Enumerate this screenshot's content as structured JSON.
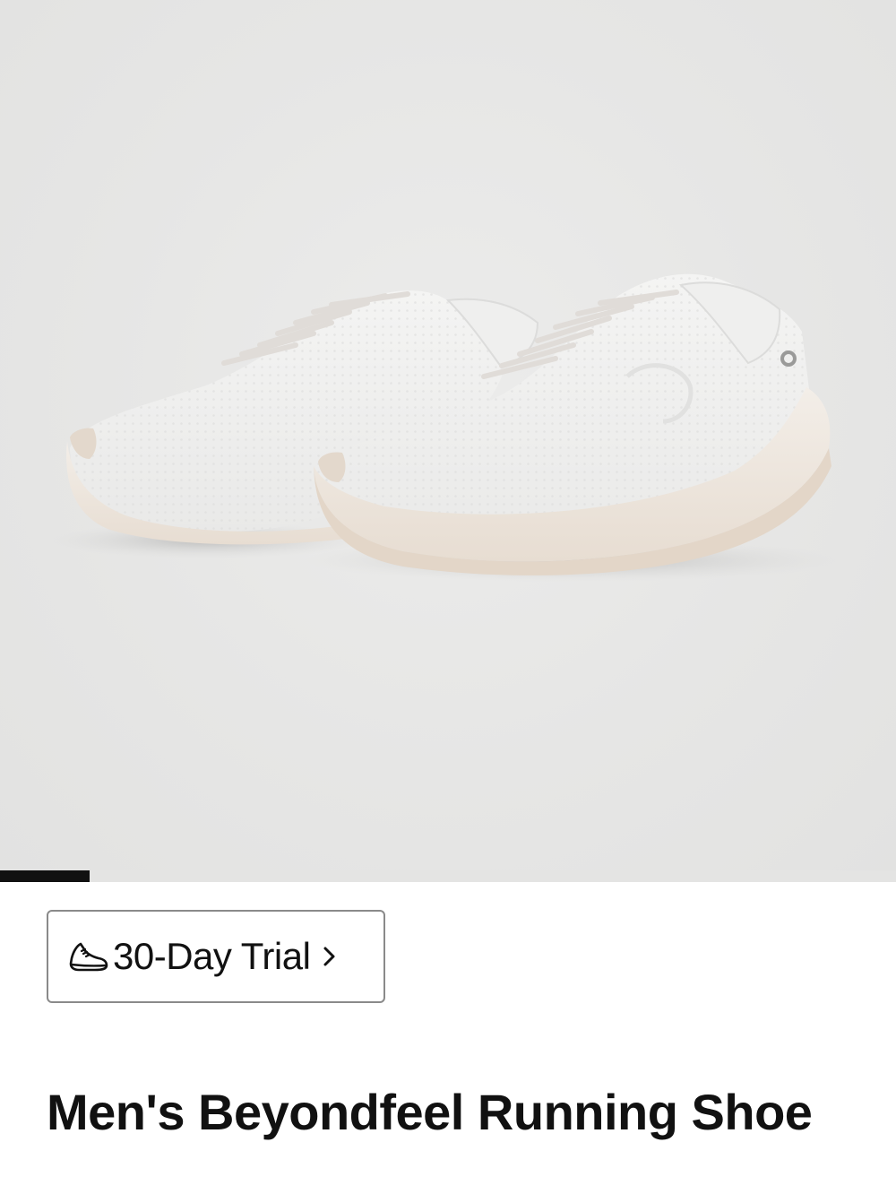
{
  "product": {
    "image_alt": "White running shoes pair",
    "gallery_position": 0.1,
    "trial_label": "30-Day Trial",
    "trial_icon": "running-shoe-icon",
    "trial_chevron": "chevron-right-icon",
    "title": "Men's Beyondfeel Running Shoe"
  },
  "colors": {
    "text": "#111111",
    "gallery_bg": "#e7e7e6",
    "progress_active": "#111111",
    "border": "#8a8a8a"
  }
}
